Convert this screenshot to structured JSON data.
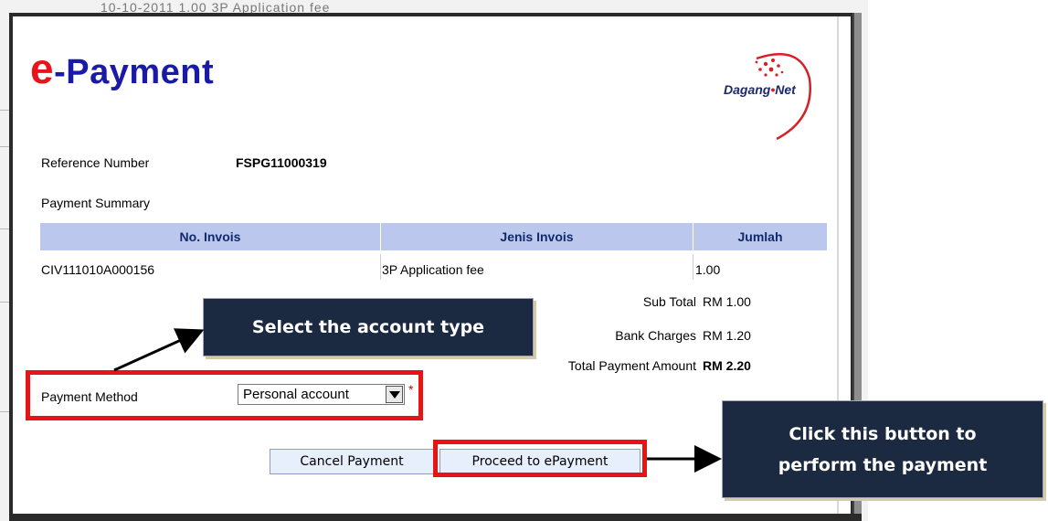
{
  "background": {
    "top_partial_text": "10-10-2011                    1.00           3P Application fee"
  },
  "header": {
    "title_e": "e",
    "title_rest": "-Payment",
    "logo_text_main": "Dagang",
    "logo_text_dot": "•",
    "logo_text_net": "Net"
  },
  "reference": {
    "label": "Reference Number",
    "value": "FSPG11000319"
  },
  "summary": {
    "heading": "Payment Summary",
    "columns": [
      "No. Invois",
      "Jenis Invois",
      "Jumlah"
    ],
    "rows": [
      {
        "no_invois": "CIV111010A000156",
        "jenis_invois": "3P Application fee",
        "jumlah": "1.00"
      }
    ],
    "sub_total_label": "Sub Total",
    "sub_total_value": "RM 1.00",
    "bank_charges_label": "Bank Charges",
    "bank_charges_value": "RM 1.20",
    "total_label": "Total Payment Amount",
    "total_value": "RM 2.20"
  },
  "payment_method": {
    "label": "Payment Method",
    "selected": "Personal account",
    "required_marker": "*"
  },
  "buttons": {
    "cancel": "Cancel Payment",
    "proceed": "Proceed to ePayment"
  },
  "callouts": {
    "select_account": "Select the account type",
    "click_button_line1": "Click this button to",
    "click_button_line2": "perform the payment"
  },
  "colors": {
    "title_blue": "#1a1aa8",
    "title_red": "#e8141b",
    "table_header_bg": "#bcc7ee",
    "highlight_red": "#e81414",
    "callout_bg": "#1b2a40"
  }
}
